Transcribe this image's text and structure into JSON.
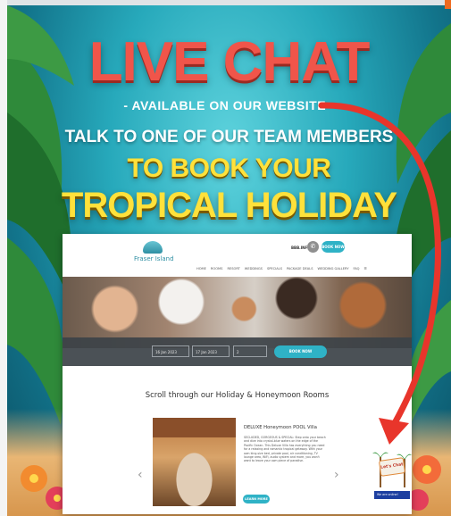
{
  "poster": {
    "headline": "LIVE CHAT",
    "subhead": "- AVAILABLE ON OUR WEBSITE -",
    "line1": "TALK TO ONE OF OUR TEAM MEMBERS",
    "line2": "TO BOOK YOUR",
    "line3": "TROPICAL HOLIDAY"
  },
  "colors": {
    "headline_red": "#f0554a",
    "headline_yellow": "#ffe13b",
    "accent_teal": "#2fb2c6",
    "arrow_red": "#e8352b"
  },
  "site": {
    "logo_text": "Fraser Island",
    "phone": "BBB.INFO",
    "book_now": "BOOK NOW",
    "nav": [
      "HOME",
      "ROOMS",
      "RESORT",
      "WEDDINGS",
      "SPECIALS",
      "PACKAGE DEALS",
      "WEDDING GALLERY",
      "FAQ"
    ],
    "search": {
      "check_in": "16 Jan 2023",
      "check_out": "17 Jan 2023",
      "guests": "2",
      "enquire": "BOOK NOW"
    },
    "section_title": "Scroll through our Holiday & Honeymoon Rooms",
    "room": {
      "title": "DELUXE Honeymoon POOL Villa",
      "description": "SECLUDED, GORGEOUS & SPECIAL: Step onto your beach and dive into crystal-blue waters on the edge of the Pacific Ocean. This Deluxe Villa has everything you need for a relaxing and romantic tropical getaway. With your own king-size bed, private pool, air conditioning, TV lounge area, WiFi, audio system and more, you won't want to leave your own piece of paradise.",
      "learn_more": "LEARN MORE"
    },
    "chat": {
      "bubble": "Let's Chat",
      "bar": "We are online!"
    }
  }
}
